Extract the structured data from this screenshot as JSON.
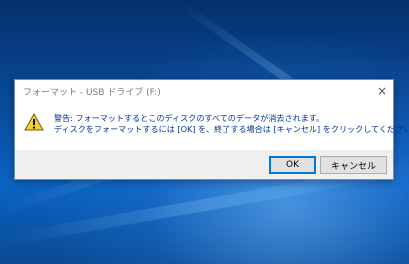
{
  "window": {
    "title": "フォーマット - USB ドライブ (F:)",
    "close_icon": "×"
  },
  "message": {
    "line1": "警告: フォーマットするとこのディスクのすべてのデータが消去されます。",
    "line2": "ディスクをフォーマットするには [OK] を、終了する場合は [キャンセル] をクリックしてください。",
    "icon": "warning-icon"
  },
  "buttons": {
    "ok_label": "OK",
    "cancel_label": "キャンセル"
  },
  "colors": {
    "message_text": "#003399",
    "focus_border": "#0078d7",
    "warning_yellow": "#f8d030"
  }
}
